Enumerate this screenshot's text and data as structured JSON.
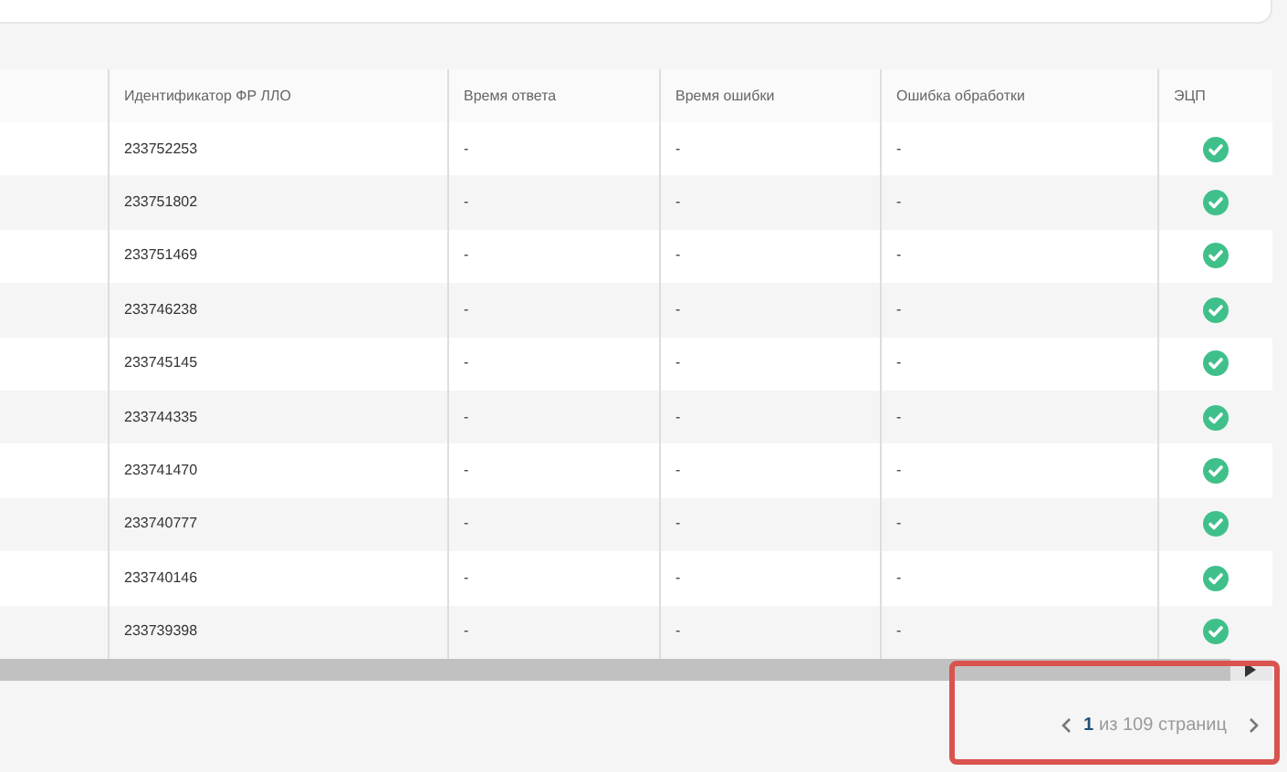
{
  "table": {
    "columns": [
      "Идентификатор ФР ЛЛО",
      "Время ответа",
      "Время ошибки",
      "Ошибка обработки",
      "ЭЦП"
    ],
    "rows": [
      {
        "id": "233752253",
        "response_time": "-",
        "error_time": "-",
        "processing_error": "-",
        "signed": true
      },
      {
        "id": "233751802",
        "response_time": "-",
        "error_time": "-",
        "processing_error": "-",
        "signed": true
      },
      {
        "id": "233751469",
        "response_time": "-",
        "error_time": "-",
        "processing_error": "-",
        "signed": true
      },
      {
        "id": "233746238",
        "response_time": "-",
        "error_time": "-",
        "processing_error": "-",
        "signed": true
      },
      {
        "id": "233745145",
        "response_time": "-",
        "error_time": "-",
        "processing_error": "-",
        "signed": true
      },
      {
        "id": "233744335",
        "response_time": "-",
        "error_time": "-",
        "processing_error": "-",
        "signed": true
      },
      {
        "id": "233741470",
        "response_time": "-",
        "error_time": "-",
        "processing_error": "-",
        "signed": true
      },
      {
        "id": "233740777",
        "response_time": "-",
        "error_time": "-",
        "processing_error": "-",
        "signed": true
      },
      {
        "id": "233740146",
        "response_time": "-",
        "error_time": "-",
        "processing_error": "-",
        "signed": true
      },
      {
        "id": "233739398",
        "response_time": "-",
        "error_time": "-",
        "processing_error": "-",
        "signed": true
      }
    ]
  },
  "pagination": {
    "current": "1",
    "total": "из 109 страниц"
  }
}
